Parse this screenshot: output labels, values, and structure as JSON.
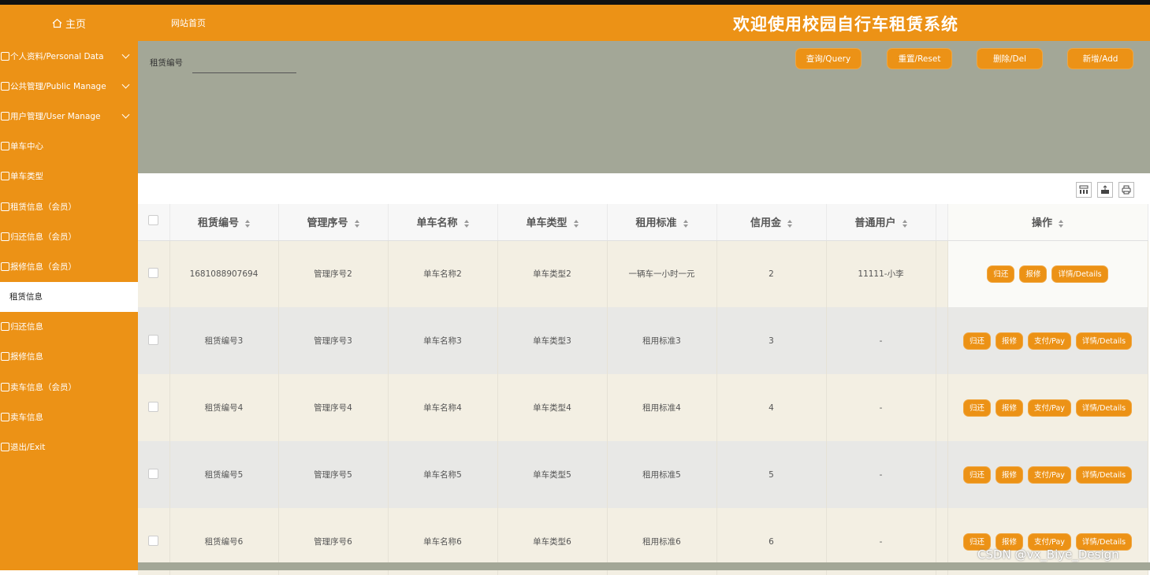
{
  "header": {
    "home": "主页",
    "site_home": "网站首页",
    "title": "欢迎使用校园自行车租赁系统"
  },
  "sidebar": {
    "items": [
      {
        "label": "个人资料/Personal Data",
        "expandable": true
      },
      {
        "label": "公共管理/Public Manage",
        "expandable": true
      },
      {
        "label": "用户管理/User Manage",
        "expandable": true
      },
      {
        "label": "单车中心",
        "expandable": false
      },
      {
        "label": "单车类型",
        "expandable": false
      },
      {
        "label": "租赁信息（会员）",
        "expandable": false
      },
      {
        "label": "归还信息（会员）",
        "expandable": false
      },
      {
        "label": "报修信息（会员）",
        "expandable": false
      },
      {
        "label": "租赁信息",
        "expandable": false,
        "active": true
      },
      {
        "label": "归还信息",
        "expandable": false
      },
      {
        "label": "报修信息",
        "expandable": false
      },
      {
        "label": "卖车信息（会员）",
        "expandable": false
      },
      {
        "label": "卖车信息",
        "expandable": false
      },
      {
        "label": "退出/Exit",
        "expandable": false
      }
    ]
  },
  "search": {
    "label": "租赁编号",
    "value": "",
    "buttons": {
      "query": "查询/Query",
      "reset": "重置/Reset",
      "delete": "删除/Del",
      "add": "新增/Add"
    }
  },
  "table": {
    "headers": [
      "租赁编号",
      "管理序号",
      "单车名称",
      "单车类型",
      "租用标准",
      "信用金",
      "普通用户",
      "操作"
    ],
    "rows": [
      {
        "rent_no": "1681088907694",
        "manage_no": "管理序号2",
        "bike_name": "单车名称2",
        "bike_type": "单车类型2",
        "standard": "一辆车一小时一元",
        "deposit": "2",
        "user": "11111-小李",
        "ops": [
          "归还",
          "报修",
          "详情/Details"
        ]
      },
      {
        "rent_no": "租赁编号3",
        "manage_no": "管理序号3",
        "bike_name": "单车名称3",
        "bike_type": "单车类型3",
        "standard": "租用标准3",
        "deposit": "3",
        "user": "-",
        "ops": [
          "归还",
          "报修",
          "支付/Pay",
          "详情/Details"
        ]
      },
      {
        "rent_no": "租赁编号4",
        "manage_no": "管理序号4",
        "bike_name": "单车名称4",
        "bike_type": "单车类型4",
        "standard": "租用标准4",
        "deposit": "4",
        "user": "-",
        "ops": [
          "归还",
          "报修",
          "支付/Pay",
          "详情/Details"
        ]
      },
      {
        "rent_no": "租赁编号5",
        "manage_no": "管理序号5",
        "bike_name": "单车名称5",
        "bike_type": "单车类型5",
        "standard": "租用标准5",
        "deposit": "5",
        "user": "-",
        "ops": [
          "归还",
          "报修",
          "支付/Pay",
          "详情/Details"
        ]
      },
      {
        "rent_no": "租赁编号6",
        "manage_no": "管理序号6",
        "bike_name": "单车名称6",
        "bike_type": "单车类型6",
        "standard": "租用标准6",
        "deposit": "6",
        "user": "-",
        "ops": [
          "归还",
          "报修",
          "支付/Pay",
          "详情/Details"
        ]
      }
    ]
  },
  "toolbar_icons": [
    "columns-icon",
    "export-icon",
    "print-icon"
  ],
  "watermark": "CSDN @vx_Biye_Design",
  "colors": {
    "accent": "#ec9216",
    "search_bg": "#a3a797",
    "row_odd": "#f3efe3",
    "row_even": "#e8e8e6"
  }
}
